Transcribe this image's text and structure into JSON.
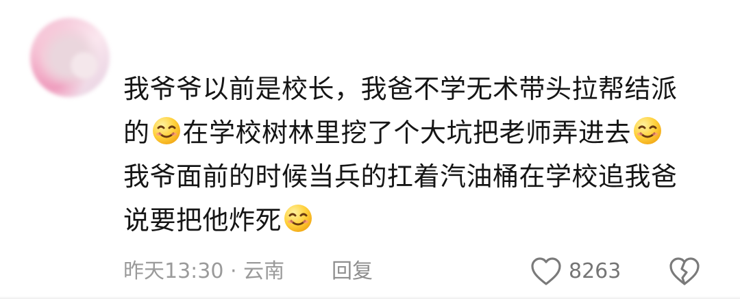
{
  "comment": {
    "avatar_icon": "blurred-user-avatar",
    "lines": [
      {
        "parts": [
          {
            "text": "我爷爷以前是校长，我爸不学无术带头拉帮结派"
          }
        ]
      },
      {
        "parts": [
          {
            "text": "的"
          },
          {
            "emoji": "smiling-face-emoji"
          },
          {
            "text": "在学校树林里挖了个大坑把老师弄进去"
          },
          {
            "emoji": "smiling-face-emoji"
          }
        ]
      },
      {
        "parts": [
          {
            "text": "我爷面前的时候当兵的扛着汽油桶在学校追我爸"
          }
        ]
      },
      {
        "parts": [
          {
            "text": "说要把他炸死"
          },
          {
            "emoji": "smiling-face-emoji"
          }
        ]
      }
    ],
    "meta": "昨天13:30 · 云南",
    "reply_label": "回复",
    "like_count": "8263",
    "like_icon": "heart-outline-icon",
    "dislike_icon": "broken-heart-icon",
    "inline_icon": "ellipsis-icon"
  },
  "colors": {
    "text": "#151515",
    "meta": "#9a9a9a",
    "emoji_face": "#ffcf46",
    "icon": "#7a7a7a"
  }
}
